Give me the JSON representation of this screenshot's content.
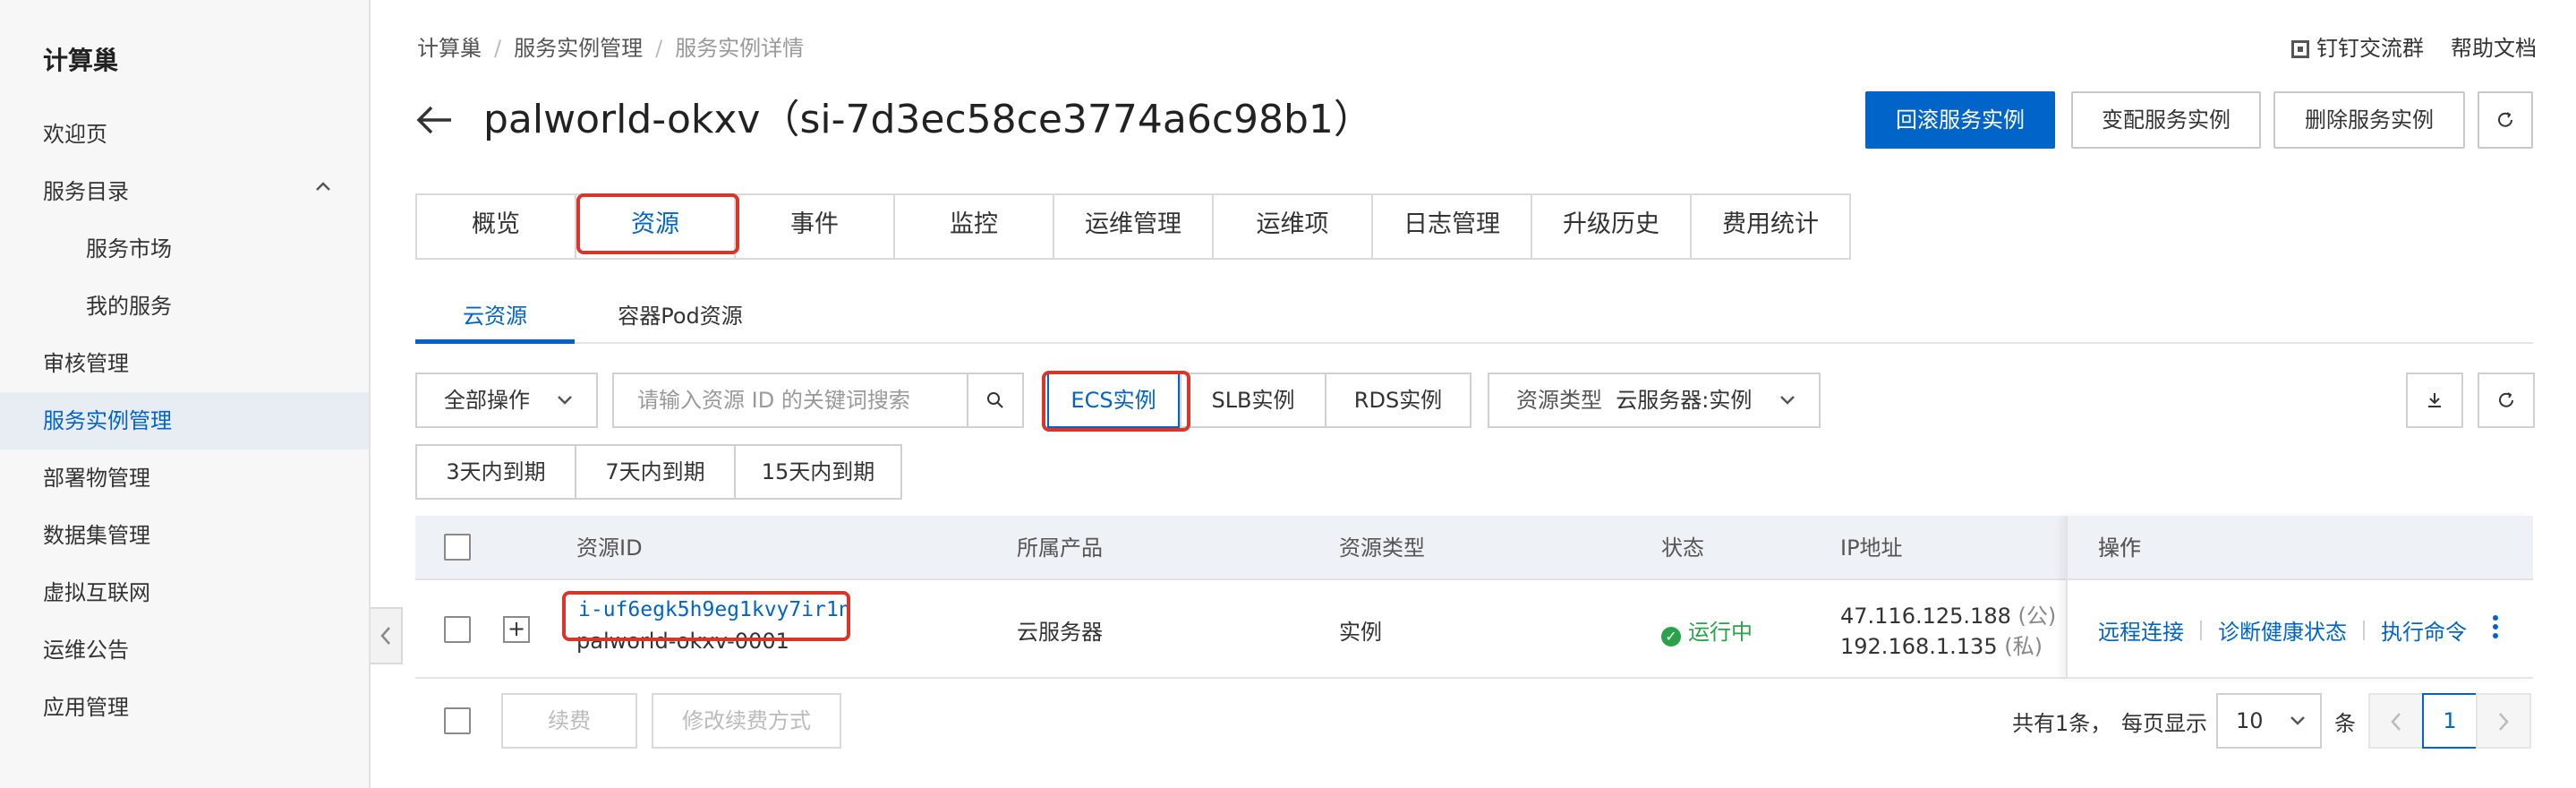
{
  "sidebar": {
    "brand": "计算巢",
    "items": [
      {
        "label": "欢迎页"
      },
      {
        "label": "服务目录"
      },
      {
        "label": "服务市场"
      },
      {
        "label": "我的服务"
      },
      {
        "label": "审核管理"
      },
      {
        "label": "服务实例管理"
      },
      {
        "label": "部署物管理"
      },
      {
        "label": "数据集管理"
      },
      {
        "label": "虚拟互联网"
      },
      {
        "label": "运维公告"
      },
      {
        "label": "应用管理"
      }
    ],
    "active": "服务实例管理",
    "collapse_glyph": "‹",
    "expand_glyph": "^"
  },
  "breadcrumb": [
    "计算巢",
    "服务实例管理",
    "服务实例详情"
  ],
  "breadcrumb_sep": "/",
  "top_links": {
    "dingtalk": "钉钉交流群",
    "help": "帮助文档"
  },
  "header": {
    "back": "←",
    "title": "palworld-okxv（si-7d3ec58ce3774a6c98b1）",
    "actions": {
      "rollback": "回滚服务实例",
      "change": "变配服务实例",
      "delete": "删除服务实例"
    }
  },
  "tabs": [
    {
      "label": "概览"
    },
    {
      "label": "资源"
    },
    {
      "label": "事件"
    },
    {
      "label": "监控"
    },
    {
      "label": "运维管理"
    },
    {
      "label": "运维项"
    },
    {
      "label": "日志管理"
    },
    {
      "label": "升级历史"
    },
    {
      "label": "费用统计"
    }
  ],
  "active_tab": "资源",
  "subtabs": [
    {
      "label": "云资源"
    },
    {
      "label": "容器Pod资源"
    }
  ],
  "active_subtab": "云资源",
  "toolbar": {
    "bulk_actions": "全部操作",
    "search_placeholder": "请输入资源 ID 的关键词搜索",
    "filters": [
      "ECS实例",
      "SLB实例",
      "RDS实例"
    ],
    "active_filter": "ECS实例",
    "resource_type_label": "资源类型",
    "resource_type_value": "云服务器:实例",
    "expiry": [
      "3天内到期",
      "7天内到期",
      "15天内到期"
    ]
  },
  "table": {
    "columns": [
      "资源ID",
      "所属产品",
      "资源类型",
      "状态",
      "IP地址",
      "操作"
    ],
    "rows": [
      {
        "resource_id": "i-uf6egk5h9eg1kvy7ir1n",
        "resource_name": "palworld-okxv-0001",
        "product": "云服务器",
        "type": "实例",
        "status": "运行中",
        "ip_public": "47.116.125.188",
        "ip_public_tag": "(公)",
        "ip_private": "192.168.1.135",
        "ip_private_tag": "(私)",
        "actions": [
          "远程连接",
          "诊断健康状态",
          "执行命令"
        ]
      }
    ]
  },
  "footer": {
    "renew": "续费",
    "modify_renew": "修改续费方式",
    "total": "共有1条，",
    "per_page_label": "每页显示",
    "per_page_value": "10",
    "unit": "条",
    "current_page": "1"
  }
}
